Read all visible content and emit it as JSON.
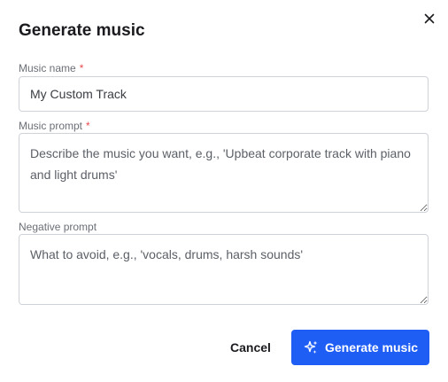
{
  "dialog": {
    "title": "Generate music",
    "close_icon": "close-icon"
  },
  "fields": {
    "name": {
      "label": "Music name",
      "required_mark": "*",
      "value": "My Custom Track"
    },
    "prompt": {
      "label": "Music prompt",
      "required_mark": "*",
      "placeholder": "Describe the music you want, e.g., 'Upbeat corporate track with piano and light drums'"
    },
    "negative": {
      "label": "Negative prompt",
      "placeholder": "What to avoid, e.g., 'vocals, drums, harsh sounds'"
    }
  },
  "actions": {
    "cancel_label": "Cancel",
    "generate_label": "Generate music",
    "generate_icon": "sparkles-icon"
  },
  "colors": {
    "primary": "#1f5ef5",
    "required": "#e5484d",
    "label": "#6b6f76",
    "border": "#cfd3d9"
  }
}
